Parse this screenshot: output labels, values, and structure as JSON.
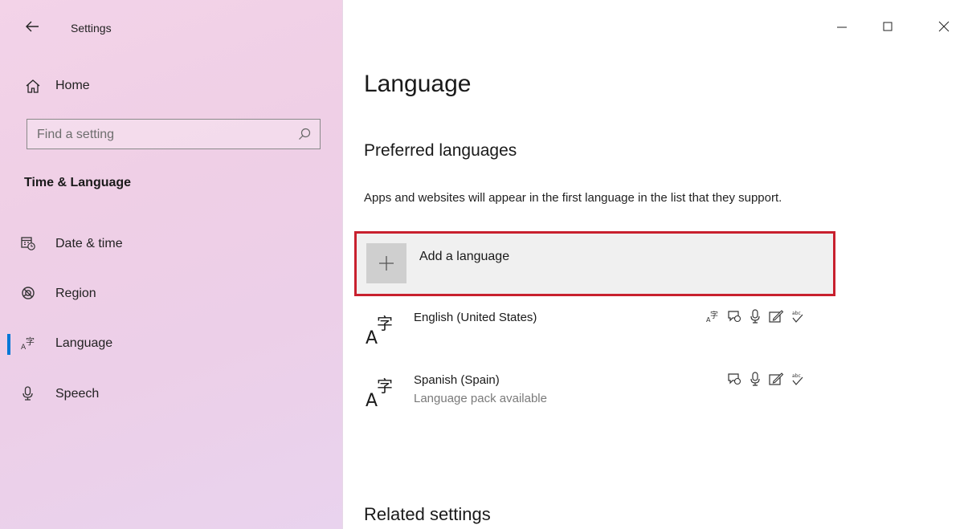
{
  "window": {
    "app_title": "Settings"
  },
  "sidebar": {
    "home_label": "Home",
    "search_placeholder": "Find a setting",
    "section_title": "Time & Language",
    "items": [
      {
        "label": "Date & time",
        "icon": "calendar-clock-icon",
        "active": false
      },
      {
        "label": "Region",
        "icon": "globe-icon",
        "active": false
      },
      {
        "label": "Language",
        "icon": "language-icon",
        "active": true
      },
      {
        "label": "Speech",
        "icon": "microphone-icon",
        "active": false
      }
    ],
    "accent_color": "#0078d7"
  },
  "main": {
    "page_title": "Language",
    "preferred_title": "Preferred languages",
    "description": "Apps and websites will appear in the first language in the list that they support.",
    "add_language_label": "Add a language",
    "highlight_color": "#c8202e",
    "languages": [
      {
        "name": "English (United States)",
        "status": "",
        "features": [
          "display-language-icon",
          "speech-bubble-icon",
          "microphone-icon",
          "handwriting-icon",
          "spellcheck-icon"
        ]
      },
      {
        "name": "Spanish (Spain)",
        "status": "Language pack available",
        "features": [
          "speech-bubble-icon",
          "microphone-icon",
          "handwriting-icon",
          "spellcheck-icon"
        ]
      }
    ],
    "related_title": "Related settings"
  }
}
